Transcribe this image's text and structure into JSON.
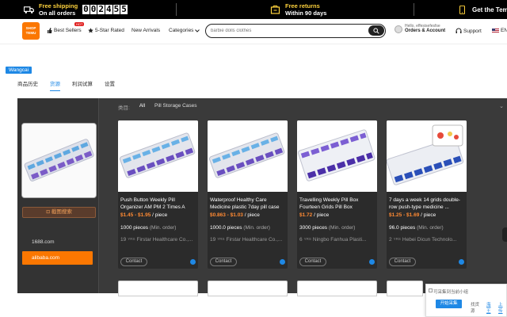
{
  "topbar": {
    "free_shipping_l1": "Free shipping",
    "free_shipping_l2": "On all orders",
    "timer": [
      "0",
      "0",
      "2",
      "4",
      "5",
      "5"
    ],
    "returns_l1": "Free returns",
    "returns_l2": "Within 90 days",
    "get_app": "Get the Tem"
  },
  "header": {
    "logo_l1": "SHOP",
    "logo_l2": "TEMU",
    "best_sellers": "Best Sellers",
    "hot_badge": "HOT",
    "five_star": "5-Star Rated",
    "new_arrivals": "New Arrivals",
    "categories": "Categories",
    "search_placeholder": "barbie dolls clothes",
    "acct_l1": "Hello, effesisefesfse",
    "acct_l2": "Orders & Account",
    "support": "Support",
    "lang": "EN"
  },
  "plugin": {
    "tag": "Wangcai",
    "tabs": [
      "商品历史",
      "货源",
      "利润试算",
      "设置"
    ],
    "active_tab_index": 1,
    "image_search_label": "截图搜索",
    "src_1688": "1688.com",
    "src_alibaba": "alibaba.com",
    "filter_label": "类目:",
    "filter_all": "All",
    "filter_category": "Pill Storage Cases"
  },
  "products": [
    {
      "title": "Push Button Weekly Pill Organizer AM PM 2 Times A Day...",
      "price": "$1.45 - $1.95",
      "price_unit": "/ piece",
      "moq": "1000 pieces",
      "moq_unit": "(Min. order)",
      "years": "19",
      "yrs_label": "YRS",
      "supplier": "Firstar Healthcare Co.,...",
      "contact": "Contact"
    },
    {
      "title": "Waterproof Healthy Care Medicine plastic 7day pill case",
      "price": "$0.863 - $1.03",
      "price_unit": "/ piece",
      "moq": "1000.0 pieces",
      "moq_unit": "(Min. order)",
      "years": "19",
      "yrs_label": "YRS",
      "supplier": "Firstar Healthcare Co.,...",
      "contact": "Contact"
    },
    {
      "title": "Travelling Weekly Pill Box Fourteen Grids Pill Box",
      "price": "$1.72",
      "price_unit": "/ piece",
      "moq": "3000 pieces",
      "moq_unit": "(Min. order)",
      "years": "6",
      "yrs_label": "YRS",
      "supplier": "Ningbo Fanhua Plasti...",
      "contact": "Contact"
    },
    {
      "title": "7 days a week 14 grids double-row push-type medicine ...",
      "price": "$1.25 - $1.69",
      "price_unit": "/ piece",
      "moq": "96.0 pieces",
      "moq_unit": "(Min. order)",
      "years": "2",
      "yrs_label": "YRS",
      "supplier": "Hebei Dicun Technolo...",
      "contact": "Contact"
    }
  ],
  "popup": {
    "msg": "可采集到当前小组",
    "start": "开始采集",
    "link1": "找货源",
    "link2": "海王",
    "link3": "上传"
  }
}
